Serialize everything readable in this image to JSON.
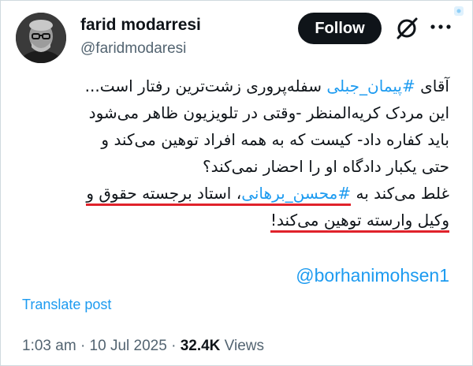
{
  "author": {
    "name": "farid modarresi",
    "handle": "@faridmodaresi"
  },
  "header": {
    "follow_label": "Follow",
    "icons": [
      "grok-icon",
      "more-icon"
    ]
  },
  "tweet": {
    "line1": {
      "prefix": "آقای ",
      "hashtag": "#پیمان_جبلی",
      "suffix": " سفله‌پروری زشت‌ترین رفتار است..."
    },
    "line2": "این مردک کریه‌المنظر -وقتی در تلویزیون ظاهر می‌شود",
    "line3": "باید کفاره داد- کیست که به همه افراد توهین می‌کند و",
    "line4": "حتی یکبار دادگاه او را احضار نمی‌کند؟",
    "line5": {
      "prefix": "غلط می‌کند به ",
      "hashtag": "#محسن_برهانی",
      "suffix": "، استاد برجسته حقوق و"
    },
    "line6": "وکیل وارسته توهین می‌کند!",
    "mention": "@borhanimohsen1"
  },
  "translate_label": "Translate post",
  "meta": {
    "time": "1:03 am",
    "date": "10 Jul 2025",
    "views_count": "32.4K",
    "views_label": "Views",
    "separator": "·"
  },
  "colors": {
    "link": "#1d9bf0",
    "text": "#0f1419",
    "secondary": "#536471",
    "underline": "#e0222b",
    "button": "#0f1419"
  }
}
